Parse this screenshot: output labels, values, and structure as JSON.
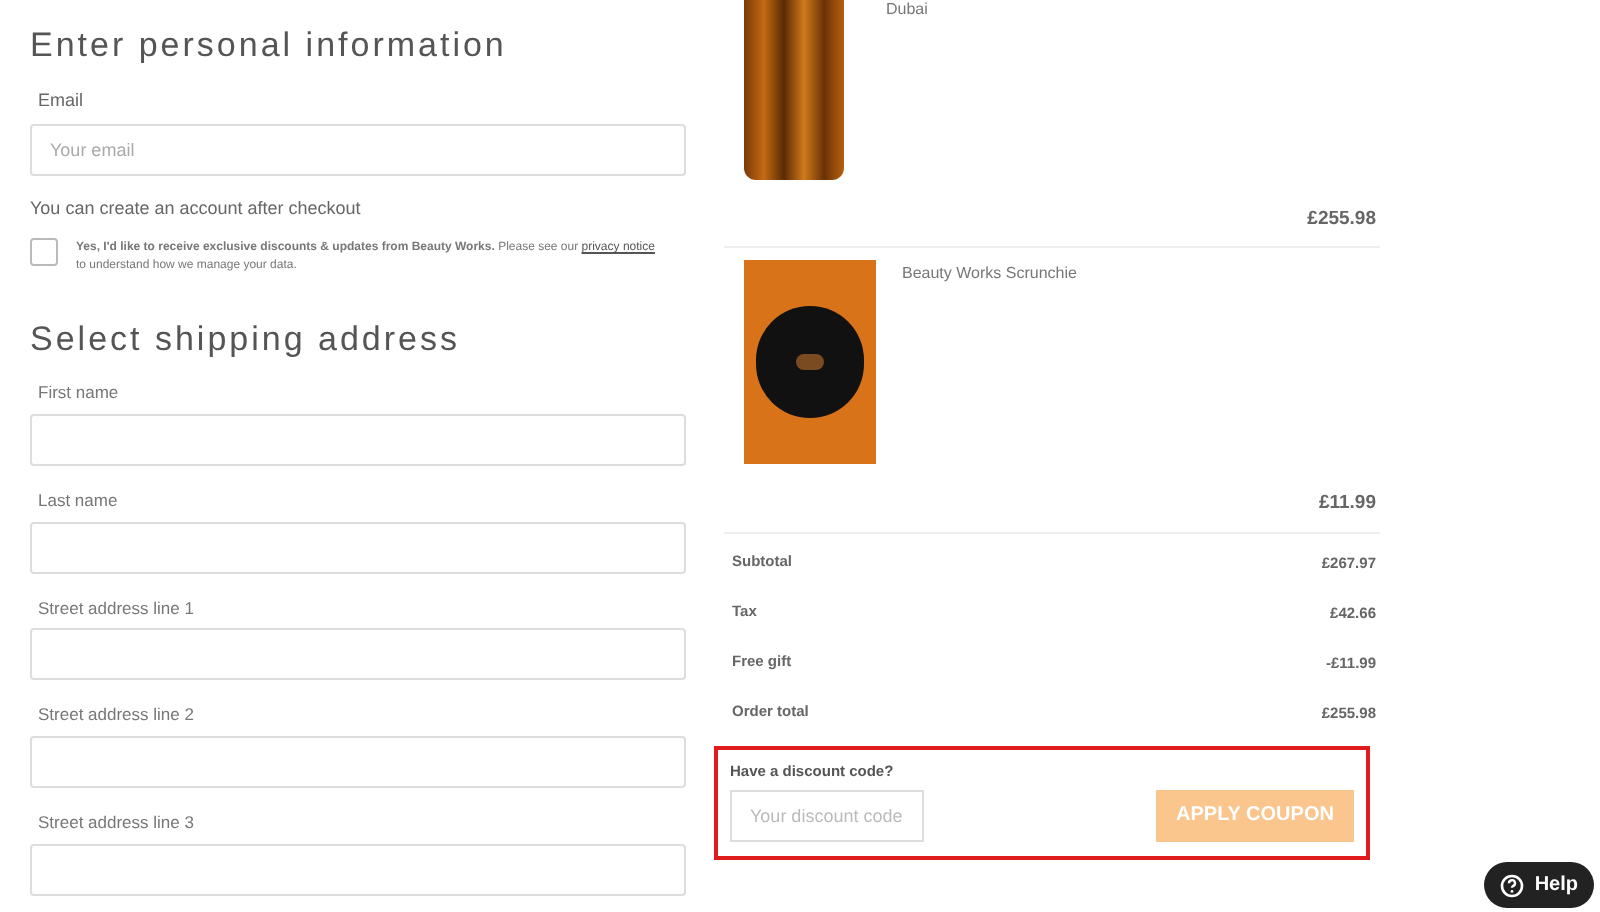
{
  "personal": {
    "heading": "Enter personal information",
    "email": {
      "label": "Email",
      "placeholder": "Your email"
    },
    "account_note": "You can create an account after checkout",
    "consent": {
      "checked": false,
      "text": "**Yes, I'd like to receive exclusive discounts & updates from Beauty Works.** Please see our",
      "link": "privacy notice",
      "text_after": "to understand how we manage your data."
    }
  },
  "shipping": {
    "heading": "Select shipping address",
    "fields": [
      {
        "label": "First name"
      },
      {
        "label": "Last name"
      },
      {
        "label": "Street address line 1"
      },
      {
        "label": "Street address line 2"
      },
      {
        "label": "Street address line 3"
      }
    ]
  },
  "cart": {
    "items": [
      {
        "kind": "extensions",
        "name": "Dubai",
        "price": "£255.98"
      },
      {
        "kind": "scrunchie",
        "name": "Beauty Works Scrunchie",
        "price": "£11.99"
      }
    ],
    "totals": [
      {
        "label": "Subtotal",
        "value": "£267.97"
      },
      {
        "label": "Tax",
        "value": "£42.66"
      },
      {
        "label": "Free gift",
        "value": "-£11.99"
      },
      {
        "label": "Order total",
        "value": "£255.98"
      }
    ],
    "discount": {
      "label": "Have a discount code?",
      "placeholder": "Your discount code",
      "button": "APPLY COUPON"
    }
  },
  "help": {
    "label": "Help"
  }
}
